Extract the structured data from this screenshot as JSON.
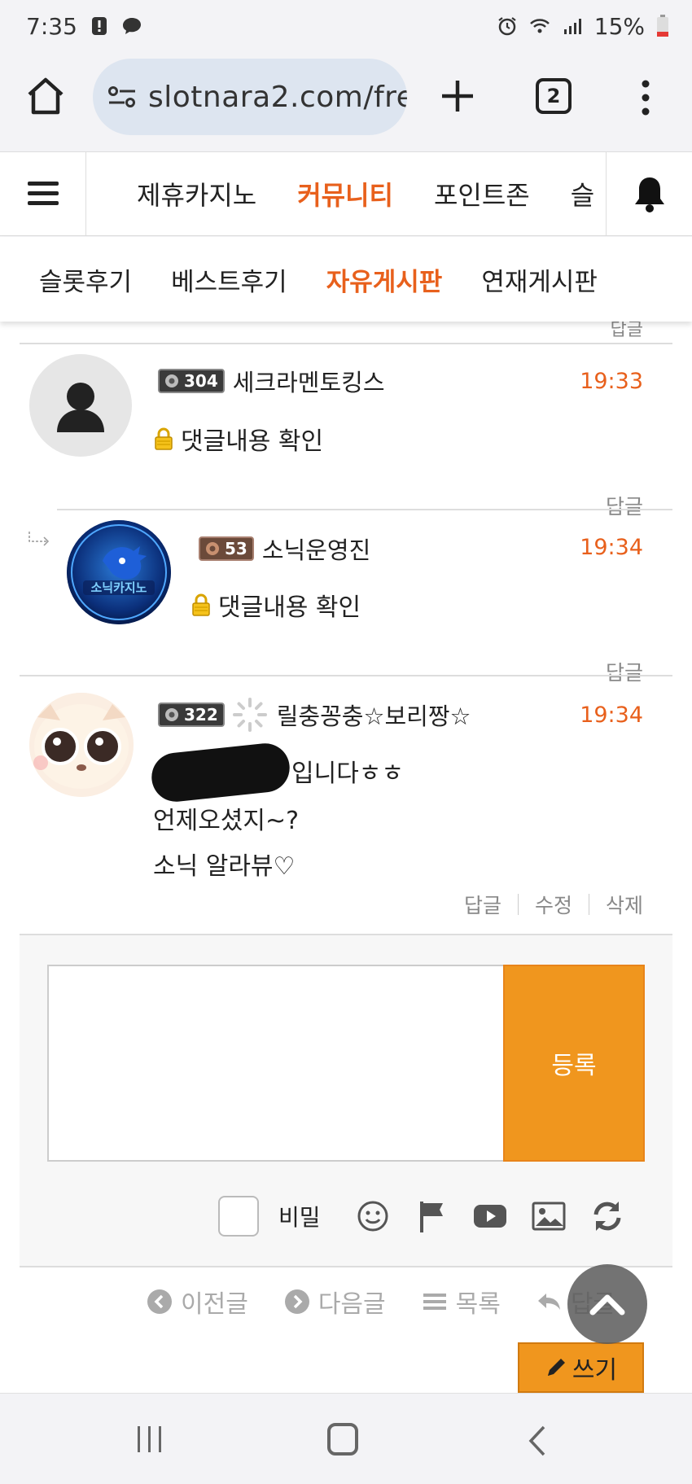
{
  "status_bar": {
    "time": "7:35",
    "battery": "15%"
  },
  "browser": {
    "url": "slotnara2.com/fre",
    "tab_count": "2"
  },
  "header": {
    "nav": [
      {
        "label": "제휴카지노",
        "active": false
      },
      {
        "label": "커뮤니티",
        "active": true
      },
      {
        "label": "포인트존",
        "active": false
      },
      {
        "label": "슬",
        "active": false
      }
    ]
  },
  "sub_nav": [
    {
      "label": "슬롯후기",
      "active": false
    },
    {
      "label": "베스트후기",
      "active": false
    },
    {
      "label": "자유게시판",
      "active": true
    },
    {
      "label": "연재게시판",
      "active": false
    }
  ],
  "partial_reply": "답글",
  "comments": [
    {
      "level": "304",
      "username": "세크라멘토킹스",
      "time": "19:33",
      "body": "댓글내용 확인",
      "secret": true,
      "reply_label": "답글"
    },
    {
      "level": "53",
      "username": "소닉운영진",
      "time": "19:34",
      "body": "댓글내용 확인",
      "secret": true,
      "reply_label": "답글",
      "avatar_text": "소닉카지노"
    },
    {
      "level": "322",
      "username": "릴충꽁충☆보리짱☆",
      "time": "19:34",
      "lines": [
        "입니다ㅎㅎ",
        "언제오셨지~?",
        "소닉 알라뷰♡"
      ],
      "reply_label": "답글",
      "edit_label": "수정",
      "delete_label": "삭제"
    }
  ],
  "form": {
    "submit_label": "등록",
    "secret_label": "비밀"
  },
  "post_nav": {
    "prev": "이전글",
    "next": "다음글",
    "list": "목록",
    "reply": "답글",
    "write": "쓰기"
  },
  "colors": {
    "accent": "#e8601c",
    "button": "#f0961e"
  }
}
